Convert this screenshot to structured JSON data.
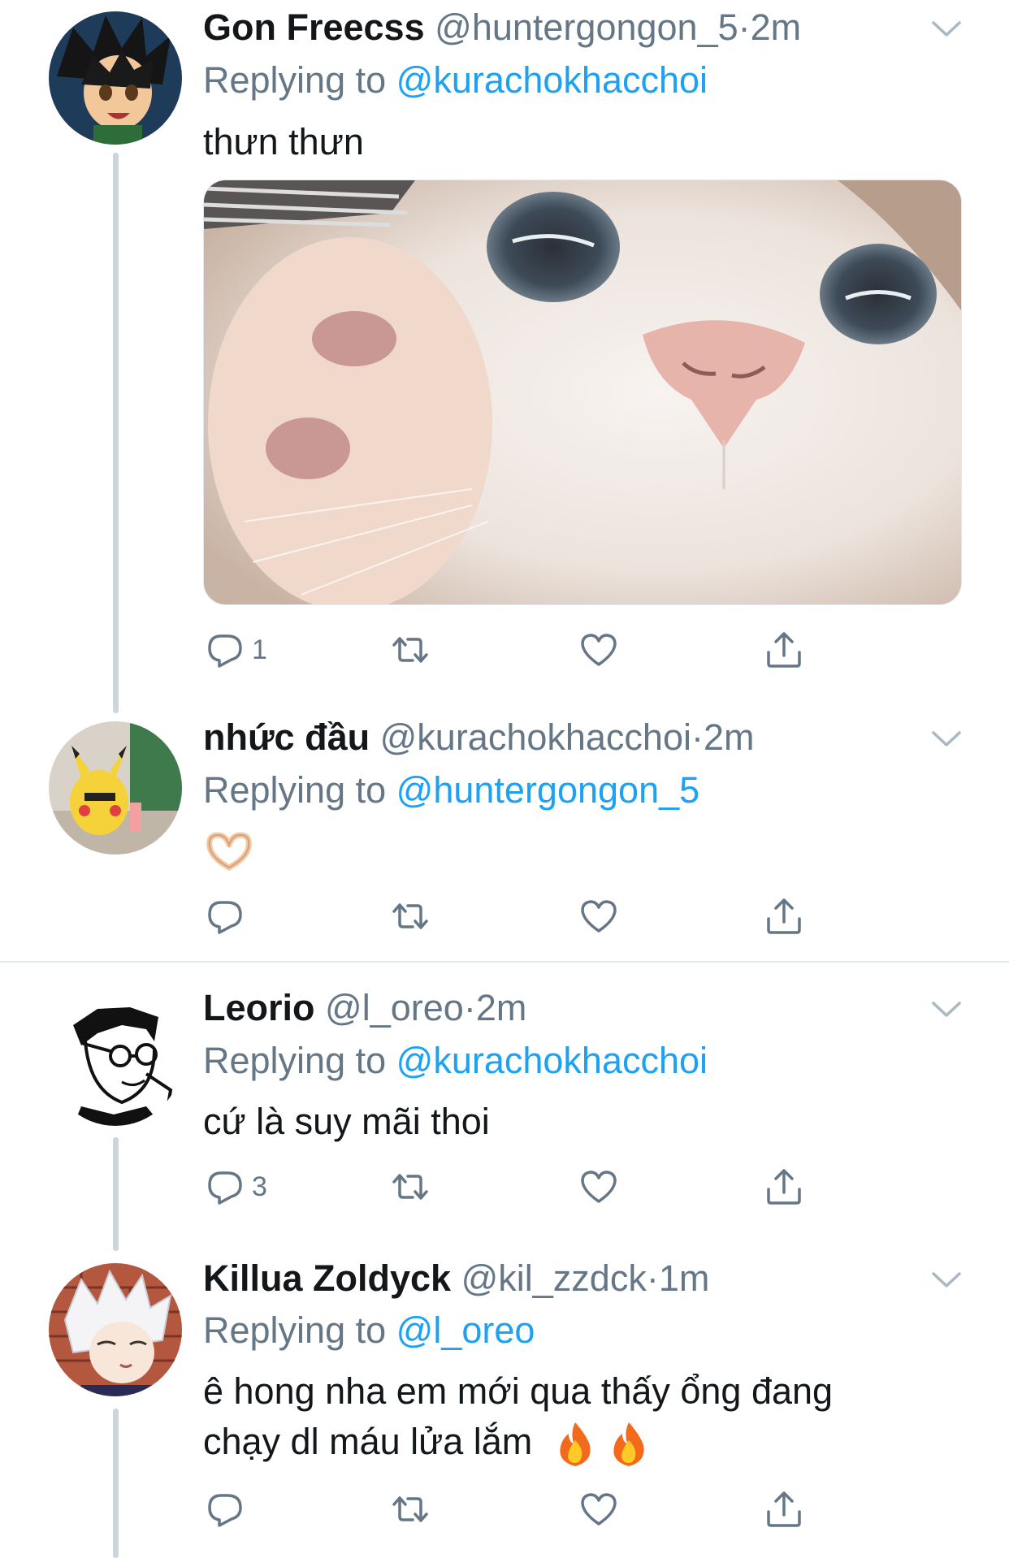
{
  "tweets": [
    {
      "name": "Gon Freecss",
      "handle": "@huntergongon_5",
      "dot": "·",
      "time": "2m",
      "replying_prefix": "Replying to",
      "replying_to": "@kurachokhacchoi",
      "text": "thưn thưn",
      "avatar": "gon-avatar",
      "media": "cat-closeup-photo",
      "reply_count": "1"
    },
    {
      "name": "nhức đầu",
      "handle": "@kurachokhacchoi",
      "dot": "·",
      "time": "2m",
      "replying_prefix": "Replying to",
      "replying_to": "@huntergongon_5",
      "text": "🫶",
      "avatar": "pikachu-avatar",
      "reply_count": ""
    },
    {
      "name": "Leorio",
      "handle": "@l_oreo",
      "dot": "·",
      "time": "2m",
      "replying_prefix": "Replying to",
      "replying_to": "@kurachokhacchoi",
      "text": "cứ là suy mãi thoi",
      "avatar": "leorio-avatar",
      "reply_count": "3"
    },
    {
      "name": "Killua Zoldyck",
      "handle": "@kil_zzdck",
      "dot": "·",
      "time": "1m",
      "replying_prefix": "Replying to",
      "replying_to": "@l_oreo",
      "text_line1": "ê hong nha em mới qua thấy ổng đang",
      "text_line2": "chạy dl máu lửa lắm",
      "avatar": "killua-avatar",
      "reply_count": ""
    }
  ],
  "icons": {
    "reply": "reply-icon",
    "retweet": "retweet-icon",
    "like": "heart-icon",
    "share": "share-icon",
    "more": "chevron-down-icon"
  },
  "colors": {
    "link": "#1da1f2",
    "secondary": "#657786",
    "thread_line": "#ccd6dd"
  }
}
